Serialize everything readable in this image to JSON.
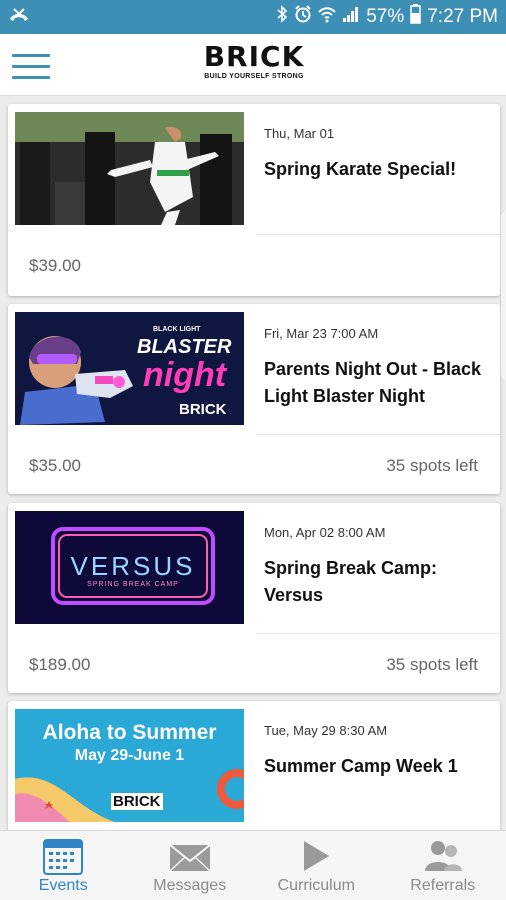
{
  "status_bar": {
    "battery_percent": "57%",
    "time": "7:27 PM"
  },
  "header": {
    "logo_text": "BRICK",
    "logo_tagline": "BUILD YOURSELF STRONG"
  },
  "events": [
    {
      "date": "Thu, Mar 01",
      "title": "Spring Karate Special!",
      "price": "$39.00",
      "spots": ""
    },
    {
      "date": "Fri, Mar 23 7:00 AM",
      "title": "Parents Night Out - Black Light Blaster Night",
      "price": "$35.00",
      "spots": "35 spots left",
      "image_text": {
        "brand_small": "BLACK LIGHT",
        "line1": "BLASTER",
        "line2": "night",
        "logo": "BRICK"
      }
    },
    {
      "date": "Mon, Apr 02 8:00 AM",
      "title": "Spring Break Camp: Versus",
      "price": "$189.00",
      "spots": "35 spots left",
      "image_text": {
        "main": "VERSUS",
        "sub": "SPRING BREAK CAMP"
      }
    },
    {
      "date": "Tue, May 29 8:30 AM",
      "title": "Summer Camp Week 1",
      "price": "",
      "spots": "",
      "image_text": {
        "line1": "Aloha to Summer",
        "line2": "May 29-June 1",
        "logo": "BRICK"
      }
    }
  ],
  "tabs": [
    {
      "label": "Events",
      "icon": "calendar-icon",
      "active": true
    },
    {
      "label": "Messages",
      "icon": "envelope-icon",
      "active": false
    },
    {
      "label": "Curriculum",
      "icon": "play-icon",
      "active": false
    },
    {
      "label": "Referrals",
      "icon": "people-icon",
      "active": false
    }
  ],
  "colors": {
    "status_bar": "#3d8fb6",
    "accent": "#2f84c6",
    "tab_inactive": "#8b8b8b"
  }
}
